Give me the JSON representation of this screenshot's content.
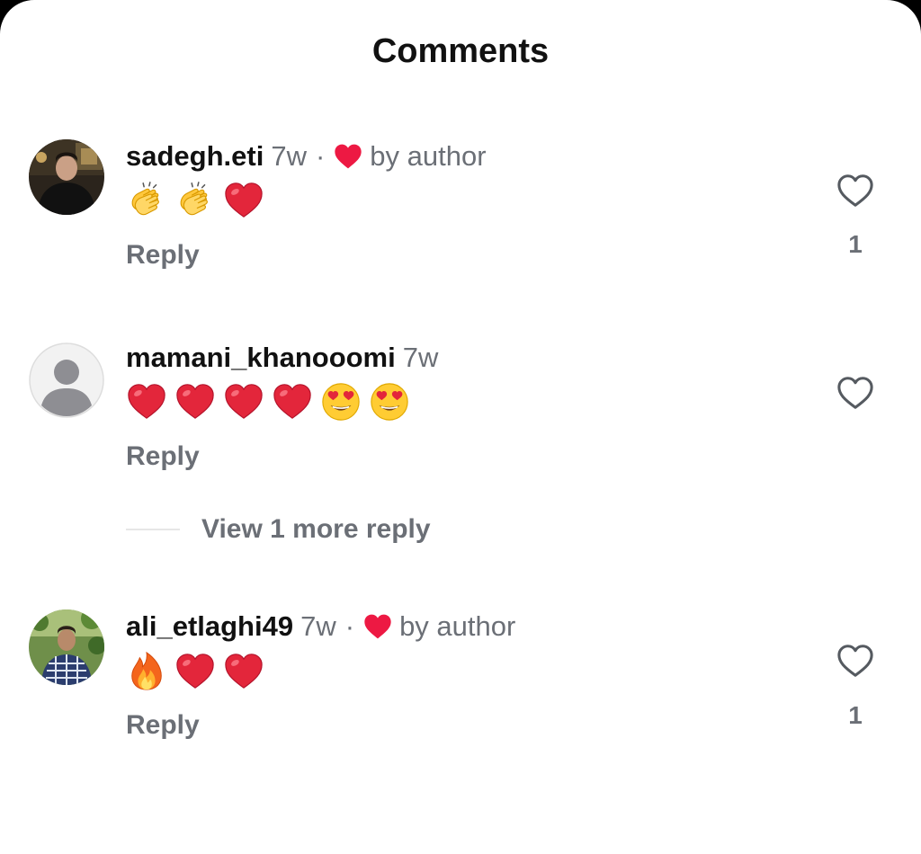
{
  "header": {
    "title": "Comments"
  },
  "comments": [
    {
      "username": "sadegh.eti",
      "time": "7w",
      "separator": "·",
      "author_liked": true,
      "by_author": "by author",
      "emojis": [
        "clapping-hands",
        "clapping-hands",
        "red-heart"
      ],
      "reply_label": "Reply",
      "like_count": "1",
      "avatar": "photo-person-dark"
    },
    {
      "username": "mamani_khanooomi",
      "time": "7w",
      "author_liked": false,
      "emojis": [
        "red-heart",
        "red-heart",
        "red-heart",
        "red-heart",
        "heart-eyes-face",
        "heart-eyes-face"
      ],
      "reply_label": "Reply",
      "view_more_label": "View 1 more reply",
      "avatar": "default-avatar"
    },
    {
      "username": "ali_etlaghi49",
      "time": "7w",
      "separator": "·",
      "author_liked": true,
      "by_author": "by author",
      "emojis": [
        "fire",
        "red-heart",
        "red-heart"
      ],
      "reply_label": "Reply",
      "like_count": "1",
      "avatar": "photo-person-plaid"
    }
  ],
  "colors": {
    "heart_red": "#ed1943",
    "secondary_text": "#6b6f76",
    "primary_text": "#111111"
  }
}
